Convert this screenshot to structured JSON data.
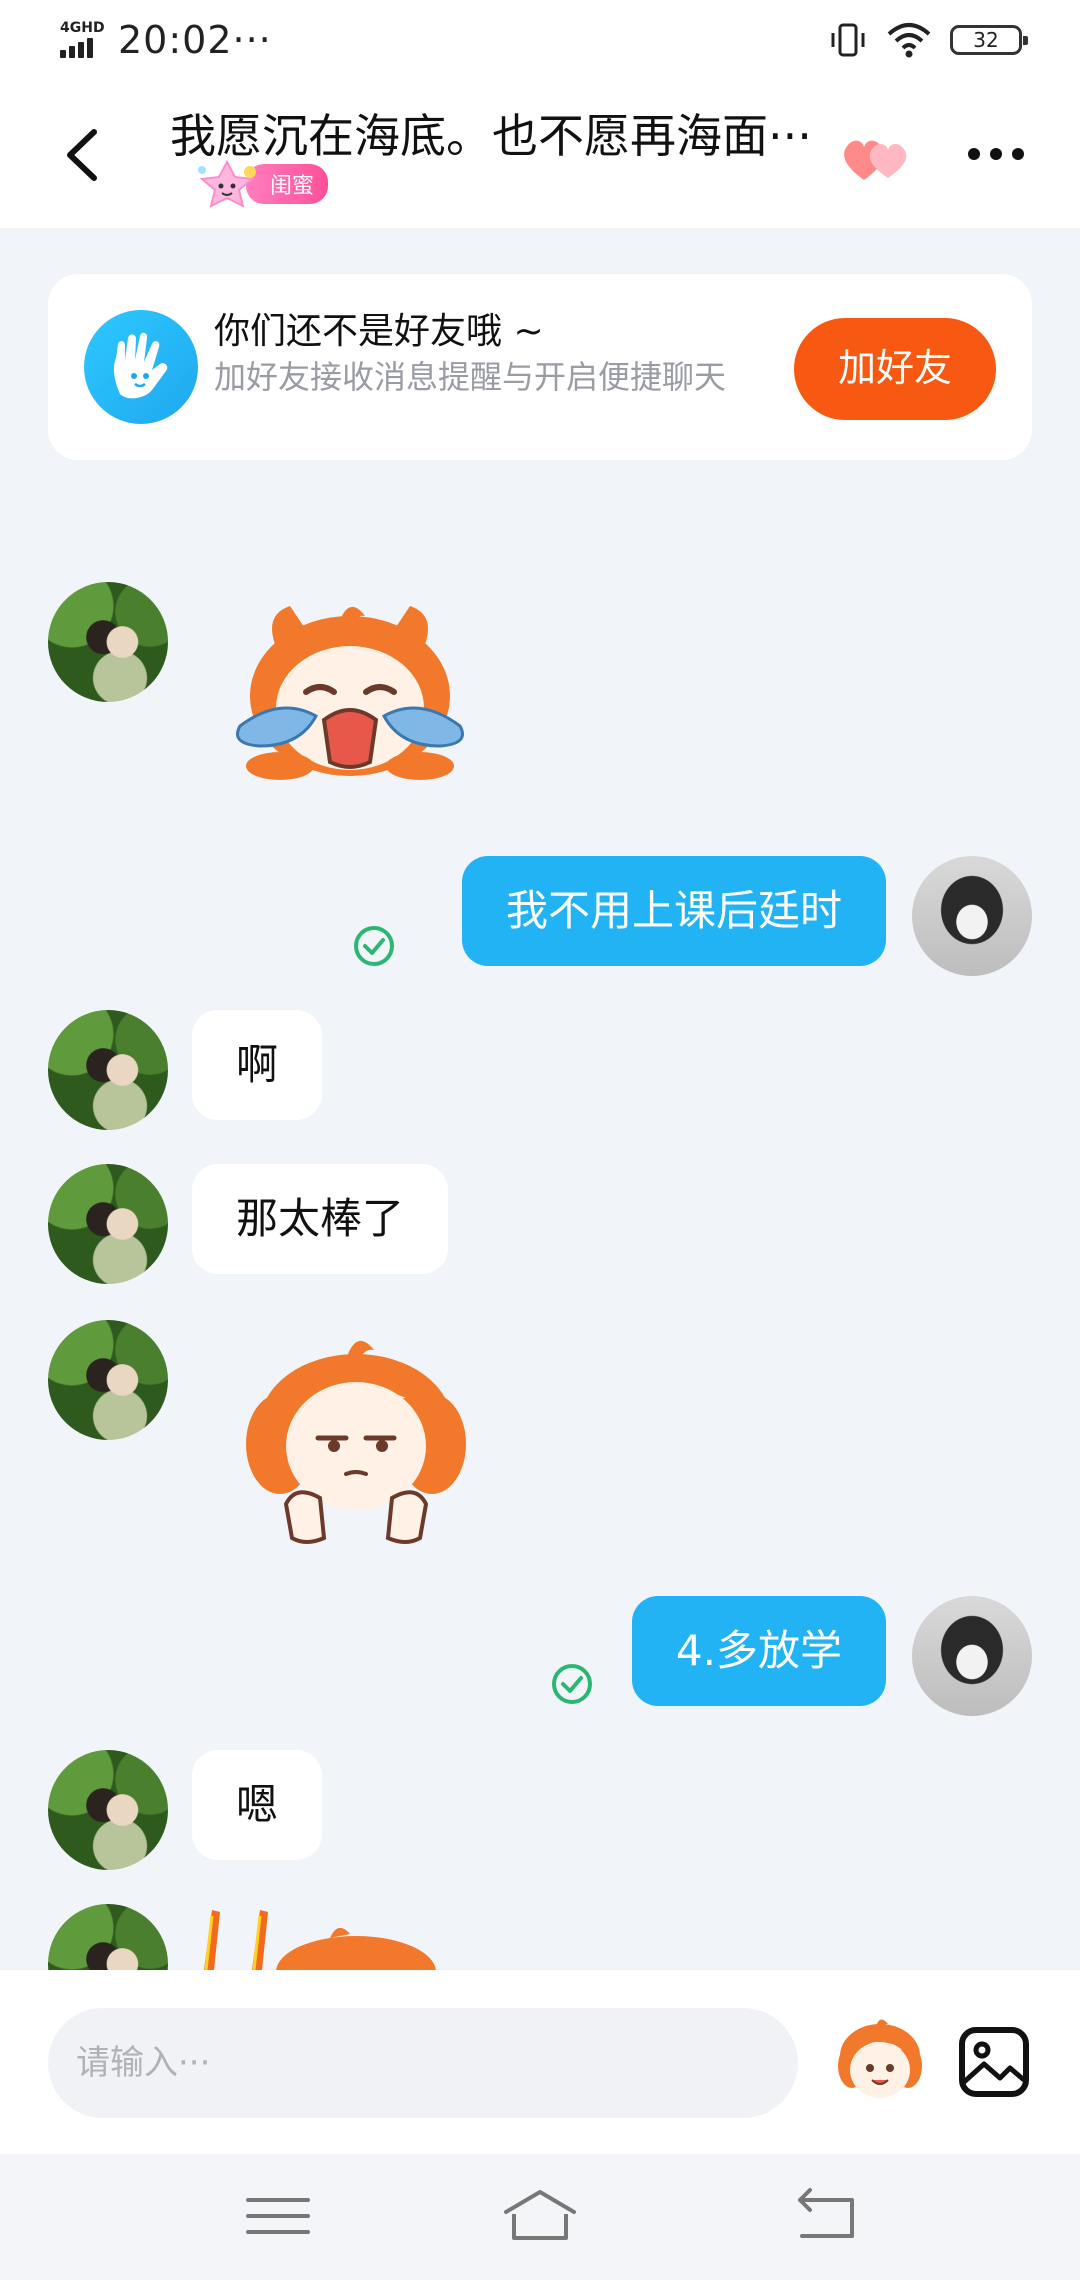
{
  "status_bar": {
    "network": "4GHD",
    "time": "20:02",
    "dots": "···",
    "battery": "32"
  },
  "header": {
    "title": "我愿沉在海底。也不愿再海面···",
    "tag": "闺蜜"
  },
  "banner": {
    "title": "你们还不是好友哦 ~",
    "desc": "加好友接收消息提醒与开启便捷聊天",
    "button": "加好友"
  },
  "messages": [
    {
      "side": "left",
      "type": "sticker",
      "sticker": "crying-cartoon"
    },
    {
      "side": "right",
      "type": "text",
      "text": "我不用上课后廷时",
      "read": true
    },
    {
      "side": "left",
      "type": "text",
      "text": "啊"
    },
    {
      "side": "left",
      "type": "text",
      "text": "那太棒了"
    },
    {
      "side": "left",
      "type": "sticker",
      "sticker": "unimpressed-cartoon"
    },
    {
      "side": "right",
      "type": "text",
      "text": "4.多放学",
      "read": true
    },
    {
      "side": "left",
      "type": "text",
      "text": "嗯"
    },
    {
      "side": "left",
      "type": "sticker",
      "sticker": "partial-cartoon"
    }
  ],
  "input": {
    "placeholder": "请输入···"
  },
  "colors": {
    "accent_blue": "#22b3f5",
    "add_friend_orange": "#f85912",
    "background": "#f1f4f9"
  }
}
